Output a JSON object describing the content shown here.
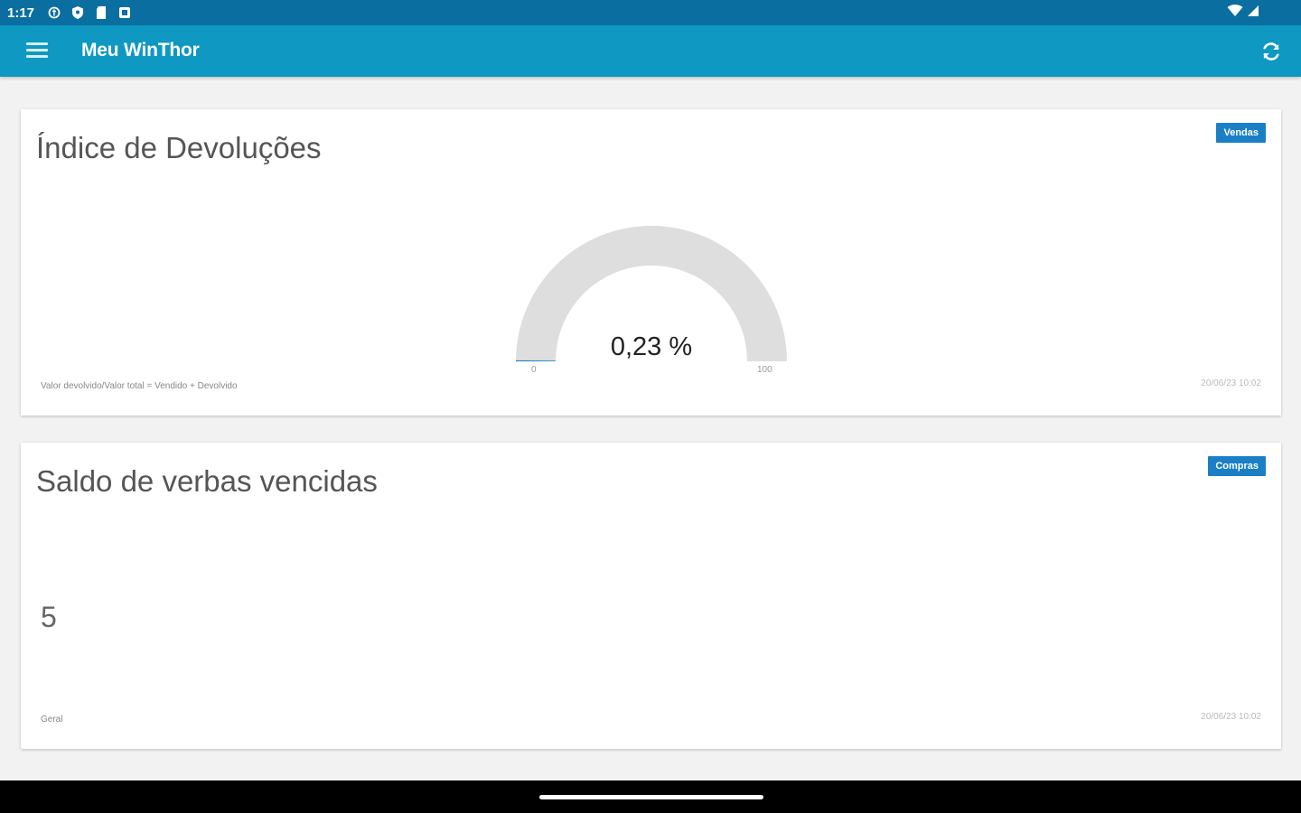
{
  "status_bar": {
    "time": "1:17",
    "icons": [
      "vpn-key-icon",
      "location-shield-icon",
      "sd-card-icon",
      "notification-square-icon",
      "wifi-icon",
      "cell-signal-icon"
    ]
  },
  "app_bar": {
    "title": "Meu WinThor",
    "icons": [
      "menu-icon",
      "refresh-icon"
    ]
  },
  "cards": [
    {
      "title": "Índice de Devoluções",
      "badge": "Vendas",
      "gauge": {
        "value": 0.23,
        "display": "0,23 %",
        "min": "0",
        "max": "100"
      },
      "footer": "Valor devolvido/Valor total = Vendido + Devolvido",
      "timestamp": "20/06/23 10:02"
    },
    {
      "title": "Saldo de verbas vencidas",
      "badge": "Compras",
      "value": "5",
      "footer": "Geral",
      "timestamp": "20/06/23 10:02"
    }
  ],
  "colors": {
    "status_bar": "#0a6fa0",
    "app_bar": "#0e98c2",
    "badge": "#1b7fc5",
    "gauge_track": "#dedede",
    "background": "#f2f2f2"
  }
}
